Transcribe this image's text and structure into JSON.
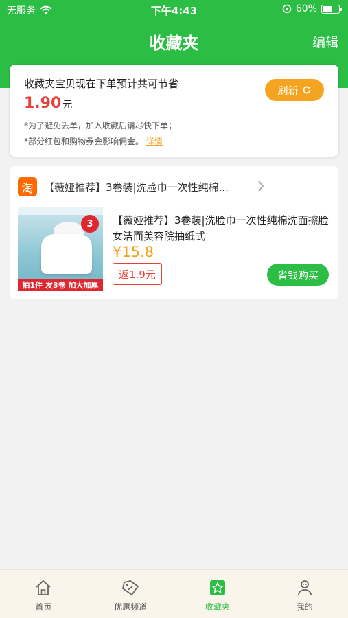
{
  "status_bar": {
    "carrier": "无服务",
    "time": "下午4:43",
    "battery": "60%"
  },
  "nav": {
    "title": "收藏夹",
    "edit_label": "编辑"
  },
  "summary": {
    "title": "收藏夹宝贝现在下单预计共可节省",
    "amount": "1.90",
    "unit": "元",
    "note1": "*为了避免丢单，加入收藏后请尽快下单；",
    "note2": "*部分红包和购物券会影响佣金。",
    "details_link": "详情",
    "refresh_label": "刷新"
  },
  "item": {
    "shop_icon_text": "淘",
    "header_title": "【薇娅推荐】3卷装|洗脸巾一次性纯棉...",
    "title": "【薇娅推荐】3卷装|洗脸巾一次性纯棉洗面擦脸女洁面美容院抽纸式",
    "price": "¥15.8",
    "rebate": "返1.9元",
    "buy_label": "省钱购买",
    "thumb_badge": "3",
    "thumb_banner": "拍1件 发3卷 加大加厚"
  },
  "tabs": [
    {
      "label": "首页",
      "icon": "home-icon"
    },
    {
      "label": "优惠频道",
      "icon": "coupon-icon"
    },
    {
      "label": "收藏夹",
      "icon": "favorites-icon"
    },
    {
      "label": "我的",
      "icon": "profile-icon"
    }
  ],
  "colors": {
    "brand_green": "#2bbd44",
    "accent_orange": "#f5a421",
    "price_red": "#e8413b"
  }
}
